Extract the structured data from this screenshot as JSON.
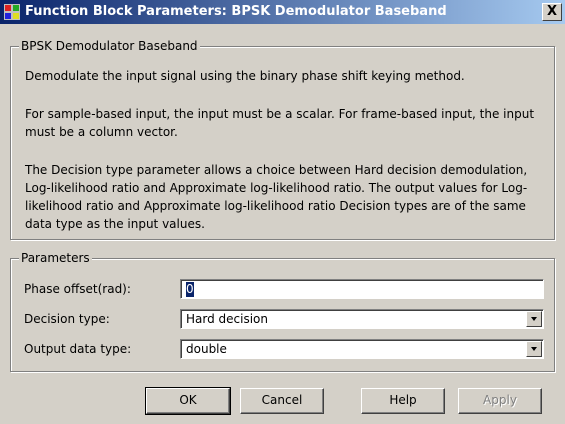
{
  "window": {
    "title": "Function Block Parameters: BPSK Demodulator Baseband",
    "close_label": "X"
  },
  "description_group": {
    "title": "BPSK Demodulator Baseband",
    "paragraphs": [
      "Demodulate the input signal using the binary phase shift keying method.",
      "For sample-based input, the input must be a scalar. For frame-based input, the input must be a column vector.",
      "The Decision type parameter allows a choice between Hard decision demodulation, Log-likelihood ratio and Approximate log-likelihood ratio.  The output values for Log-likelihood ratio and Approximate log-likelihood ratio Decision types are of the same data type as the input values."
    ]
  },
  "parameters_group": {
    "title": "Parameters",
    "phase_offset": {
      "label": "Phase offset(rad):",
      "value": "0"
    },
    "decision_type": {
      "label": "Decision type:",
      "value": "Hard decision"
    },
    "output_data_type": {
      "label": "Output data type:",
      "value": "double"
    }
  },
  "buttons": {
    "ok": "OK",
    "cancel": "Cancel",
    "help": "Help",
    "apply": "Apply"
  }
}
